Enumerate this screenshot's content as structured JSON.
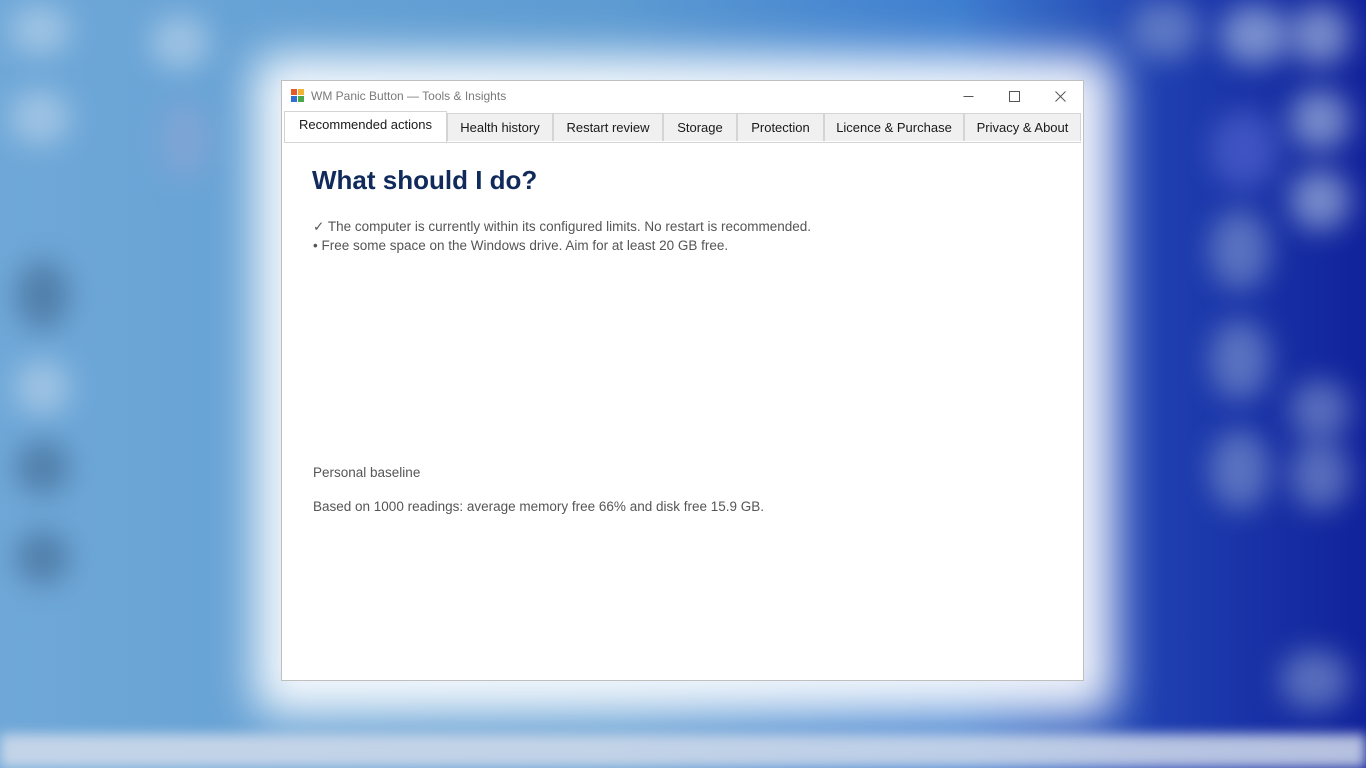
{
  "window": {
    "title": "WM Panic Button — Tools & Insights",
    "controls": {
      "minimize": "—",
      "maximize": "☐",
      "close": "✕"
    }
  },
  "tabs": [
    {
      "label": "Recommended actions",
      "active": true
    },
    {
      "label": "Health history"
    },
    {
      "label": "Restart review"
    },
    {
      "label": "Storage"
    },
    {
      "label": "Protection"
    },
    {
      "label": "Licence & Purchase"
    },
    {
      "label": "Privacy & About"
    }
  ],
  "main": {
    "heading": "What should I do?",
    "recommendations": [
      "✓ The computer is currently within its configured limits. No restart is recommended.",
      "• Free some space on the Windows drive. Aim for at least 20 GB free."
    ],
    "baseline_title": "Personal baseline",
    "baseline_text": "Based on 1000 readings: average memory free 66% and disk free 15.9 GB."
  },
  "colors": {
    "heading": "#102a5c",
    "body_text": "#555555",
    "tab_bg": "#f0f0f0"
  }
}
